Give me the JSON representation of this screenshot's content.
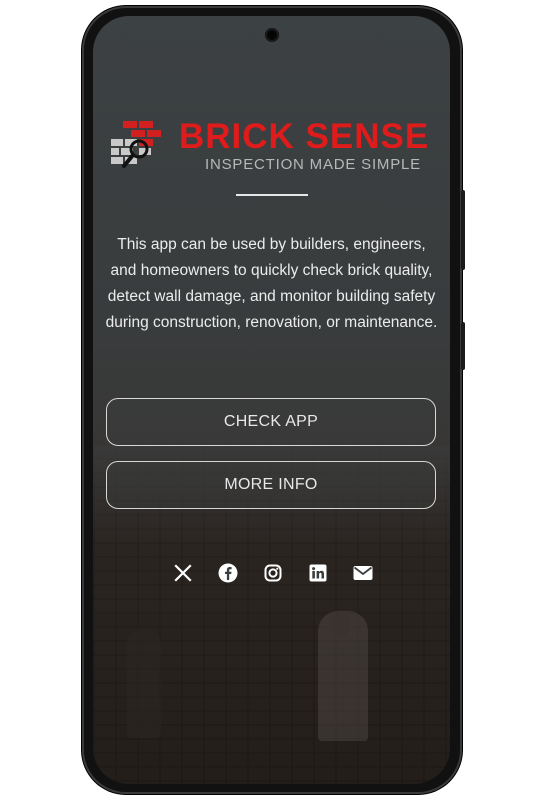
{
  "app": {
    "brand_name": "BRICK SENSE",
    "tagline": "INSPECTION MADE SIMPLE"
  },
  "description": "This app can be used by builders, engineers, and homeowners to quickly check brick quality, detect wall damage, and monitor building safety during construction, renovation, or maintenance.",
  "buttons": {
    "check_app": "CHECK APP",
    "more_info": "MORE INFO"
  },
  "social_icons": [
    "x-icon",
    "facebook-icon",
    "instagram-icon",
    "linkedin-icon",
    "email-icon"
  ],
  "colors": {
    "brand_red": "#e01b1b",
    "text": "#ececec",
    "button_border": "#d8d8d8"
  }
}
